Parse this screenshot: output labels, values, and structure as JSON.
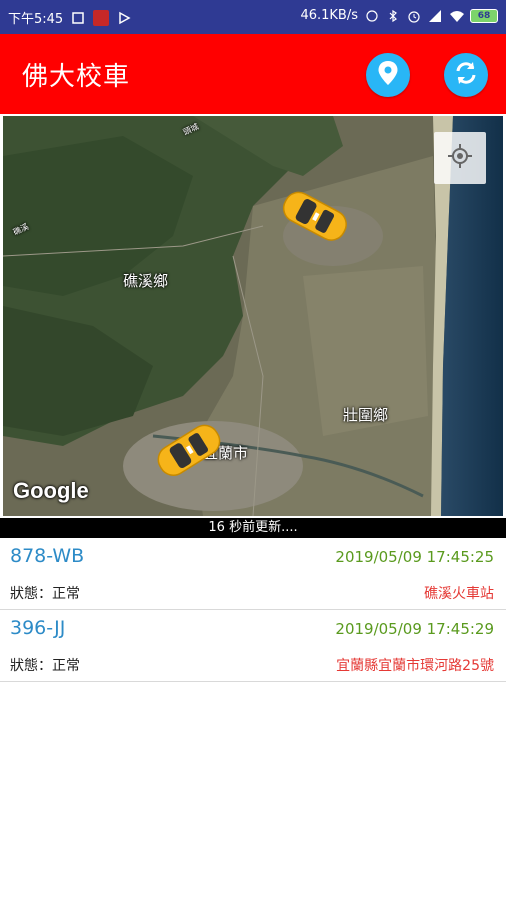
{
  "status_bar": {
    "time": "下午5:45",
    "net_speed": "46.1KB/s",
    "battery": "68"
  },
  "app": {
    "title": "佛大校車"
  },
  "map": {
    "labels": {
      "jiaoxi": "礁溪鄉",
      "zhuangwei": "壯圍鄉",
      "yilan_city": "宜蘭市",
      "small_top": "頭城",
      "small_left": "礁溪"
    },
    "attribution": "Google"
  },
  "update_text": "16 秒前更新....",
  "buses": [
    {
      "plate": "878-WB",
      "time": "2019/05/09 17:45:25",
      "status": "狀態：正常",
      "location": "礁溪火車站"
    },
    {
      "plate": "396-JJ",
      "time": "2019/05/09 17:45:29",
      "status": "狀態：正常",
      "location": "宜蘭縣宜蘭市環河路25號"
    }
  ],
  "colors": {
    "app_bar": "#ff0000",
    "status_bar": "#2f3a93",
    "plate": "#2d8bc7",
    "time": "#5a9a1e",
    "location": "#e53935",
    "button": "#29b6f6"
  },
  "icons": [
    "map-pin-icon",
    "refresh-icon",
    "my-location-icon",
    "bus-car-icon"
  ]
}
